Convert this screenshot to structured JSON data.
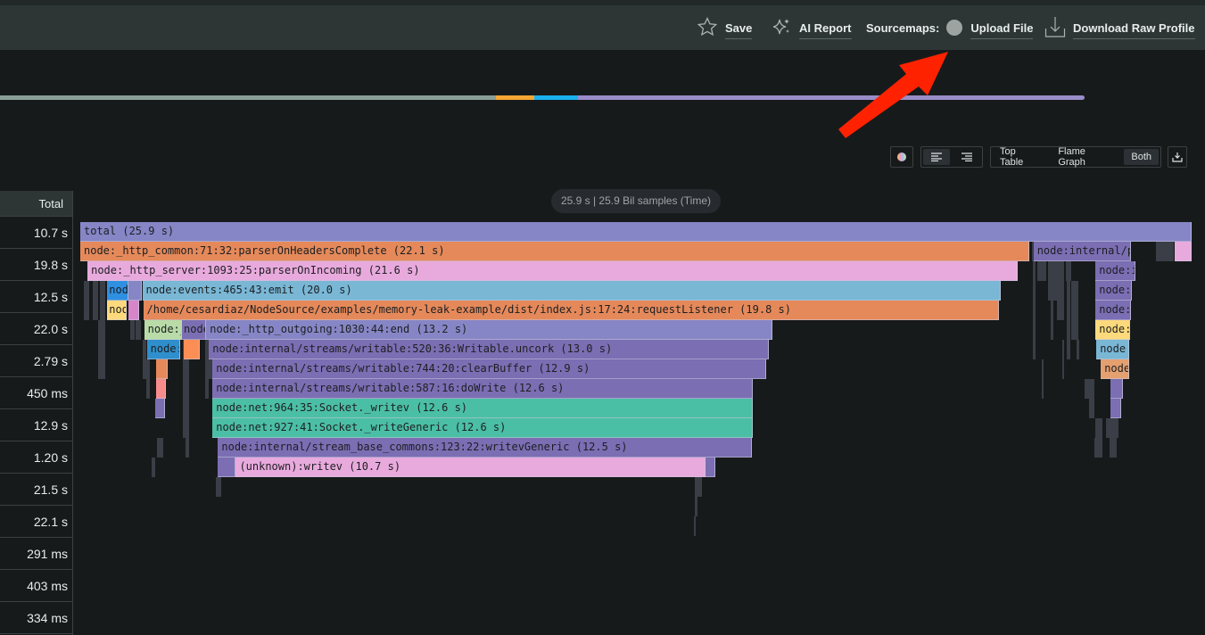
{
  "toolbar": {
    "save_label": "Save",
    "ai_report_label": "AI Report",
    "sourcemaps_label": "Sourcemaps:",
    "upload_label": "Upload File",
    "download_label": "Download Raw Profile"
  },
  "minimap": {
    "segments": [
      {
        "name": "gc-idle",
        "color": "#8a9e97",
        "fraction": 0.457
      },
      {
        "name": "yellow",
        "color": "#f5a733",
        "fraction": 0.036
      },
      {
        "name": "blue",
        "color": "#1ab1ef",
        "fraction": 0.04
      },
      {
        "name": "purple",
        "color": "#9a8cc8",
        "fraction": 0.467
      }
    ]
  },
  "controls": {
    "view_tabs": [
      {
        "label": "Top Table",
        "active": false
      },
      {
        "label": "Flame Graph",
        "active": false
      },
      {
        "label": "Both",
        "active": true
      }
    ]
  },
  "table": {
    "header": "Total",
    "rows": [
      "10.7 s",
      "19.8 s",
      "12.5 s",
      "22.0 s",
      "2.79 s",
      "450 ms",
      "12.9 s",
      "1.20 s",
      "21.5 s",
      "22.1 s",
      "291 ms",
      "403 ms",
      "334 ms"
    ]
  },
  "flamegraph": {
    "summary": "25.9 s | 25.9 Bil samples (Time)",
    "frames": [
      {
        "label": "total (25.9 s)",
        "color": "#8686c6",
        "depth": 0,
        "start": 0.0,
        "end": 1.0
      },
      {
        "label": "node:_http_common:71:32:parserOnHeadersComplete (22.1 s)",
        "color": "#e5895a",
        "depth": 1,
        "start": 0.0,
        "end": 0.8537
      },
      {
        "label": "node:internal/process/task_queues",
        "color": "#7b6eb3",
        "depth": 1,
        "start": 0.8577,
        "end": 0.9458
      },
      {
        "label": "",
        "color": "#e8aadd",
        "depth": 1,
        "start": 0.9847,
        "end": 1.0
      },
      {
        "label": "node:_http_server:1093:25:parserOnIncoming (21.6 s)",
        "color": "#e8aadd",
        "depth": 2,
        "start": 0.0065,
        "end": 0.8432
      },
      {
        "label": "node:internal/timers",
        "color": "#7b6eb3",
        "depth": 2,
        "start": 0.9135,
        "end": 0.9491
      },
      {
        "label": "node:internal/async_hooks",
        "color": "#2f8fe0",
        "depth": 3,
        "start": 0.0243,
        "end": 0.0437
      },
      {
        "label": "",
        "color": "#8686c6",
        "depth": 3,
        "start": 0.0437,
        "end": 0.055
      },
      {
        "label": "node:events:465:43:emit (20.0 s)",
        "color": "#79b7d5",
        "depth": 3,
        "start": 0.0558,
        "end": 0.8286
      },
      {
        "label": "node:internal/timers",
        "color": "#7b6eb3",
        "depth": 3,
        "start": 0.9135,
        "end": 0.9466
      },
      {
        "label": "node:internal/async_hooks",
        "color": "#fcd97c",
        "depth": 4,
        "start": 0.0243,
        "end": 0.0421
      },
      {
        "label": "",
        "color": "#d785c9",
        "depth": 4,
        "start": 0.0437,
        "end": 0.0526
      },
      {
        "label": "/home/cesardiaz/NodeSource/examples/memory-leak-example/dist/index.js:17:24:requestListener (19.8 s)",
        "color": "#e5895a",
        "depth": 4,
        "start": 0.0566,
        "end": 0.827
      },
      {
        "label": "node:internal/timers",
        "color": "#7b6eb3",
        "depth": 4,
        "start": 0.9135,
        "end": 0.9458
      },
      {
        "label": "node:_http_outgoing",
        "color": "#b8dba8",
        "depth": 5,
        "start": 0.0575,
        "end": 0.0915
      },
      {
        "label": "node:_http_outgoing",
        "color": "#7b6eb3",
        "depth": 5,
        "start": 0.0915,
        "end": 0.1134
      },
      {
        "label": "node:_http_outgoing:1030:44:end (13.2 s)",
        "color": "#8686c6",
        "depth": 5,
        "start": 0.1134,
        "end": 0.6227
      },
      {
        "label": "node:_http_outgoing",
        "color": "#fcd97c",
        "depth": 5,
        "start": 0.9135,
        "end": 0.9449
      },
      {
        "label": "node:net",
        "color": "#2f8fcc",
        "depth": 6,
        "start": 0.0599,
        "end": 0.0899
      },
      {
        "label": "",
        "color": "#fb8e55",
        "depth": 6,
        "start": 0.0932,
        "end": 0.1077
      },
      {
        "label": "node:internal/streams/writable:520:36:Writable.uncork (13.0 s)",
        "color": "#7b6eb3",
        "depth": 6,
        "start": 0.1158,
        "end": 0.6194
      },
      {
        "label": "node:events",
        "color": "#79b7d5",
        "depth": 6,
        "start": 0.9143,
        "end": 0.9442
      },
      {
        "label": "",
        "color": "#e5895a",
        "depth": 7,
        "start": 0.068,
        "end": 0.0785
      },
      {
        "label": "node:internal/streams/writable:744:20:clearBuffer (12.9 s)",
        "color": "#7b6eb3",
        "depth": 7,
        "start": 0.119,
        "end": 0.617
      },
      {
        "label": "node:_http_server",
        "color": "#e5a070",
        "depth": 7,
        "start": 0.9183,
        "end": 0.9442
      },
      {
        "label": "",
        "color": "#f58b8b",
        "depth": 8,
        "start": 0.068,
        "end": 0.0769
      },
      {
        "label": "node:internal/streams/writable:587:16:doWrite (12.6 s)",
        "color": "#7b6eb3",
        "depth": 8,
        "start": 0.119,
        "end": 0.6048
      },
      {
        "label": "",
        "color": "#7b6eb3",
        "depth": 8,
        "start": 0.9272,
        "end": 0.9385
      },
      {
        "label": "",
        "color": "#7b6eb3",
        "depth": 9,
        "start": 0.0672,
        "end": 0.0761
      },
      {
        "label": "node:net:964:35:Socket._writev (12.6 s)",
        "color": "#4bbfa5",
        "depth": 9,
        "start": 0.119,
        "end": 0.6048
      },
      {
        "label": "",
        "color": "#7b6eb3",
        "depth": 9,
        "start": 0.9272,
        "end": 0.9369
      },
      {
        "label": "node:net:927:41:Socket._writeGeneric (12.6 s)",
        "color": "#4bbfa5",
        "depth": 10,
        "start": 0.119,
        "end": 0.6048
      },
      {
        "label": "node:internal/stream_base_commons:123:22:writevGeneric (12.5 s)",
        "color": "#7b6eb3",
        "depth": 11,
        "start": 0.1239,
        "end": 0.604
      },
      {
        "label": "",
        "color": "#7b6eb3",
        "depth": 12,
        "start": 0.1239,
        "end": 0.14
      },
      {
        "label": "(unknown):writev (10.7 s)",
        "color": "#e8aadd",
        "depth": 12,
        "start": 0.14,
        "end": 0.5623
      },
      {
        "label": "",
        "color": "#7b6eb3",
        "depth": 12,
        "start": 0.5623,
        "end": 0.5712
      }
    ]
  }
}
